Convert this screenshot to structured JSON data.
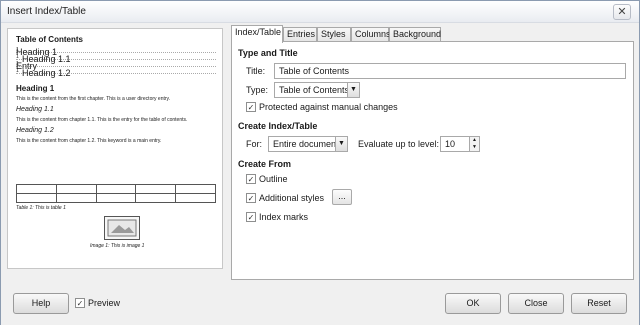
{
  "window": {
    "title": "Insert Index/Table",
    "close_glyph": "✕"
  },
  "preview": {
    "toc_title": "Table of Contents",
    "toc_entries": [
      {
        "label": "Heading 1",
        "page": "1"
      },
      {
        "label": "Heading 1.1",
        "page": "1"
      },
      {
        "label": "Entry",
        "page": "1"
      },
      {
        "label": "Heading 1.2",
        "page": "1"
      }
    ],
    "heading1": "Heading 1",
    "text1": "This is the content from the first chapter. This is a user directory entry.",
    "heading11": "Heading 1.1",
    "text11": "This is the content from chapter 1.1. This is the entry for the table of contents.",
    "heading12": "Heading 1.2",
    "text12": "This is the content from chapter 1.2. This keyword is a main entry.",
    "table_caption": "Table 1: This is table 1",
    "image_caption": "Image 1: This is image 1"
  },
  "tabs": [
    "Index/Table",
    "Entries",
    "Styles",
    "Columns",
    "Background"
  ],
  "type_title": {
    "section": "Type and Title",
    "title_label": "Title:",
    "title_value": "Table of Contents",
    "type_label": "Type:",
    "type_value": "Table of Contents",
    "protected_label": "Protected against manual changes"
  },
  "create_index": {
    "section": "Create Index/Table",
    "for_label": "For:",
    "for_value": "Entire document",
    "level_label": "Evaluate up to level:",
    "level_value": "10"
  },
  "create_from": {
    "section": "Create From",
    "outline": "Outline",
    "additional_styles": "Additional styles",
    "styles_button": "...",
    "index_marks": "Index marks"
  },
  "buttons": {
    "help": "Help",
    "preview": "Preview",
    "ok": "OK",
    "close": "Close",
    "reset": "Reset"
  },
  "check_glyph": "✓",
  "arrow_glyph": "▼"
}
